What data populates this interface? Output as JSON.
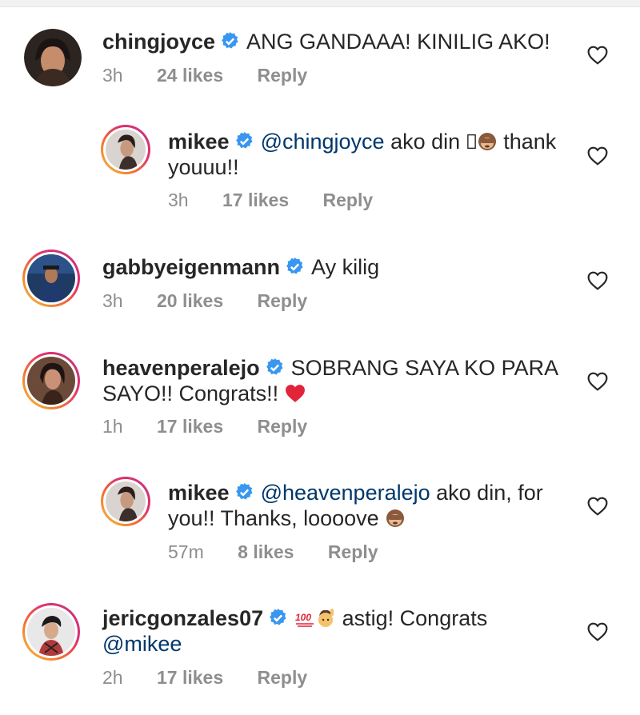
{
  "comments": [
    {
      "username": "chingjoyce",
      "text": "ANG GANDAAA! KINILIG AKO!",
      "time": "3h",
      "likes": "24 likes",
      "reply": "Reply"
    },
    {
      "username": "mikee",
      "mention": "@chingjoyce",
      "text_a": "ako din",
      "text_b": "thank",
      "text_c": "youuu!!",
      "emojis": [
        "broken-glyph",
        "see-no-evil-monkey"
      ],
      "time": "3h",
      "likes": "17 likes",
      "reply": "Reply"
    },
    {
      "username": "gabbyeigenmann",
      "text": "Ay kilig",
      "time": "3h",
      "likes": "20 likes",
      "reply": "Reply"
    },
    {
      "username": "heavenperalejo",
      "text_a": "SOBRANG SAYA KO PARA",
      "text_b": "SAYO!! Congrats!!",
      "emojis": [
        "red-heart"
      ],
      "time": "1h",
      "likes": "17 likes",
      "reply": "Reply"
    },
    {
      "username": "mikee",
      "mention": "@heavenperalejo",
      "text_a": "ako din, for",
      "text_b": "you!! Thanks, loooove",
      "emojis": [
        "see-no-evil-monkey"
      ],
      "time": "57m",
      "likes": "8 likes",
      "reply": "Reply"
    },
    {
      "username": "jericgonzales07",
      "emojis": [
        "hundred-points",
        "person-raising-hand"
      ],
      "text_a": "astig! Congrats",
      "mention": "@mikee",
      "time": "2h",
      "likes": "17 likes",
      "reply": "Reply"
    }
  ],
  "colors": {
    "text": "#262626",
    "meta": "#8e8e8e",
    "mention": "#00376b",
    "verified": "#3897f0"
  },
  "icons": [
    "verified-badge-icon",
    "heart-outline-icon"
  ]
}
